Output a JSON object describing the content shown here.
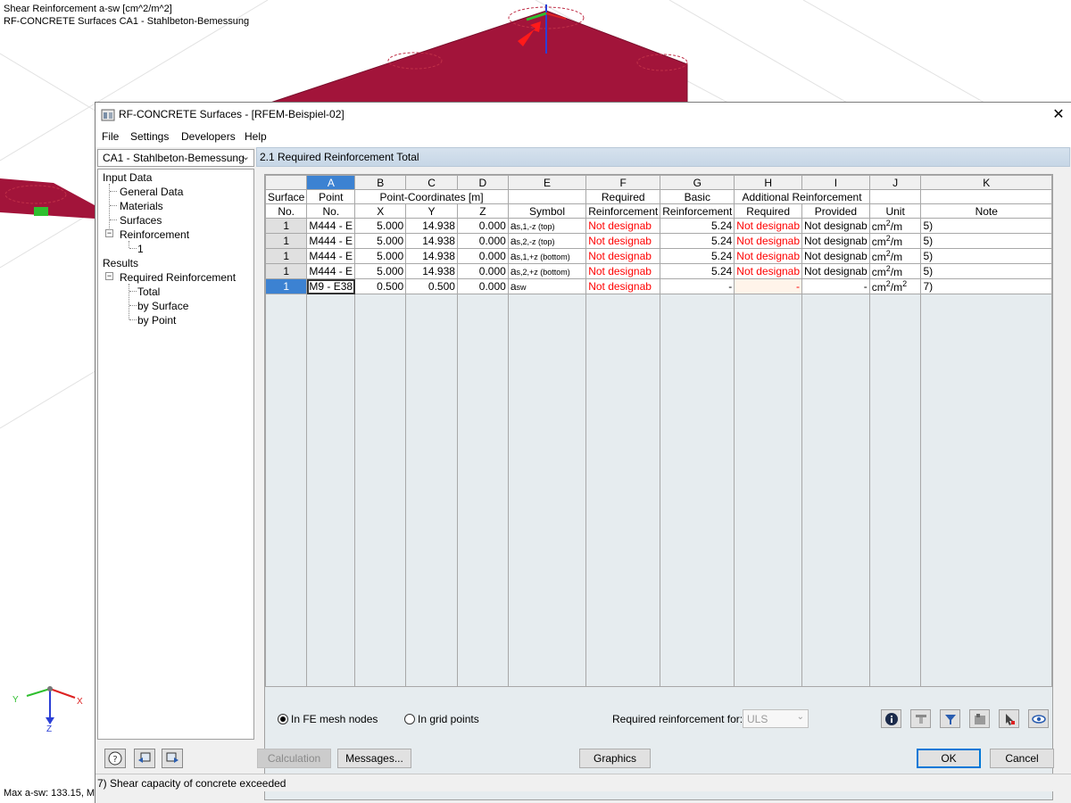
{
  "viewport": {
    "title_line1": "Shear Reinforcement a-sw [cm^2/m^2]",
    "title_line2": "RF-CONCRETE Surfaces CA1 - Stahlbeton-Bemessung",
    "max_text": "Max a-sw: 133.15, M",
    "axes": {
      "x": "X",
      "y": "Y",
      "z": "Z"
    },
    "surface_color": "#a2143a"
  },
  "dialog": {
    "title": "RF-CONCRETE Surfaces - [RFEM-Beispiel-02]",
    "close_glyph": "✕",
    "menu": [
      "File",
      "Settings",
      "Developers",
      "Help"
    ]
  },
  "sidebar": {
    "case_select": "CA1 - Stahlbeton-Bemessung",
    "tree": {
      "input_data": "Input Data",
      "general_data": "General Data",
      "materials": "Materials",
      "surfaces": "Surfaces",
      "reinforcement": "Reinforcement",
      "reinforcement_1": "1",
      "results": "Results",
      "required_reinforcement": "Required Reinforcement",
      "total": "Total",
      "by_surface": "by Surface",
      "by_point": "by Point"
    }
  },
  "section": {
    "title": "2.1 Required Reinforcement Total"
  },
  "table": {
    "col_letters": [
      "A",
      "B",
      "C",
      "D",
      "E",
      "F",
      "G",
      "H",
      "I",
      "J",
      "K"
    ],
    "header": {
      "surface_top": "Surface",
      "surface_bottom": "No.",
      "point_top": "Point",
      "point_bottom": "No.",
      "coords_top": "Point-Coordinates [m]",
      "x": "X",
      "y": "Y",
      "z": "Z",
      "symbol": "Symbol",
      "required_top": "Required",
      "required_bottom": "Reinforcement",
      "basic_top": "Basic",
      "basic_bottom": "Reinforcement",
      "additional_top": "Additional Reinforcement",
      "add_required": "Required",
      "add_provided": "Provided",
      "unit": "Unit",
      "note": "Note"
    },
    "rows": [
      {
        "surface": "1",
        "point": "M444 - E",
        "x": "5.000",
        "y": "14.938",
        "z": "0.000",
        "sym_main": "a",
        "sym_sub": "s,1,-z (top)",
        "required": "Not designab",
        "basic": "5.24",
        "add_required": "Not designab",
        "add_provided": "Not designab",
        "unit_base": "cm",
        "unit_exp": "2",
        "unit_tail": "/m",
        "note": "5)"
      },
      {
        "surface": "1",
        "point": "M444 - E",
        "x": "5.000",
        "y": "14.938",
        "z": "0.000",
        "sym_main": "a",
        "sym_sub": "s,2,-z (top)",
        "required": "Not designab",
        "basic": "5.24",
        "add_required": "Not designab",
        "add_provided": "Not designab",
        "unit_base": "cm",
        "unit_exp": "2",
        "unit_tail": "/m",
        "note": "5)"
      },
      {
        "surface": "1",
        "point": "M444 - E",
        "x": "5.000",
        "y": "14.938",
        "z": "0.000",
        "sym_main": "a",
        "sym_sub": "s,1,+z (bottom)",
        "required": "Not designab",
        "basic": "5.24",
        "add_required": "Not designab",
        "add_provided": "Not designab",
        "unit_base": "cm",
        "unit_exp": "2",
        "unit_tail": "/m",
        "note": "5)"
      },
      {
        "surface": "1",
        "point": "M444 - E",
        "x": "5.000",
        "y": "14.938",
        "z": "0.000",
        "sym_main": "a",
        "sym_sub": "s,2,+z (bottom)",
        "required": "Not designab",
        "basic": "5.24",
        "add_required": "Not designab",
        "add_provided": "Not designab",
        "unit_base": "cm",
        "unit_exp": "2",
        "unit_tail": "/m",
        "note": "5)"
      },
      {
        "surface": "1",
        "point": "M9 - E38",
        "x": "0.500",
        "y": "0.500",
        "z": "0.000",
        "sym_main": "a",
        "sym_sub": "sw",
        "required": "Not designab",
        "basic": "-",
        "add_required": "-",
        "add_provided": "-",
        "unit_base": "cm",
        "unit_exp": "2",
        "unit_tail": "/m",
        "unit_exp2": "2",
        "note": "7)"
      }
    ]
  },
  "options": {
    "radio_fe": "In FE mesh nodes",
    "radio_grid": "In grid points",
    "required_for_label": "Required reinforcement for:",
    "required_for_value": "ULS",
    "required_for_placeholder": "ULS"
  },
  "buttons": {
    "calculation": "Calculation",
    "messages": "Messages...",
    "graphics": "Graphics",
    "ok": "OK",
    "cancel": "Cancel"
  },
  "status": {
    "text": "7) Shear capacity of concrete exceeded"
  },
  "colors": {
    "accent": "#3c82d2",
    "error": "#ff0000",
    "header_band": "#c6d6e6"
  }
}
